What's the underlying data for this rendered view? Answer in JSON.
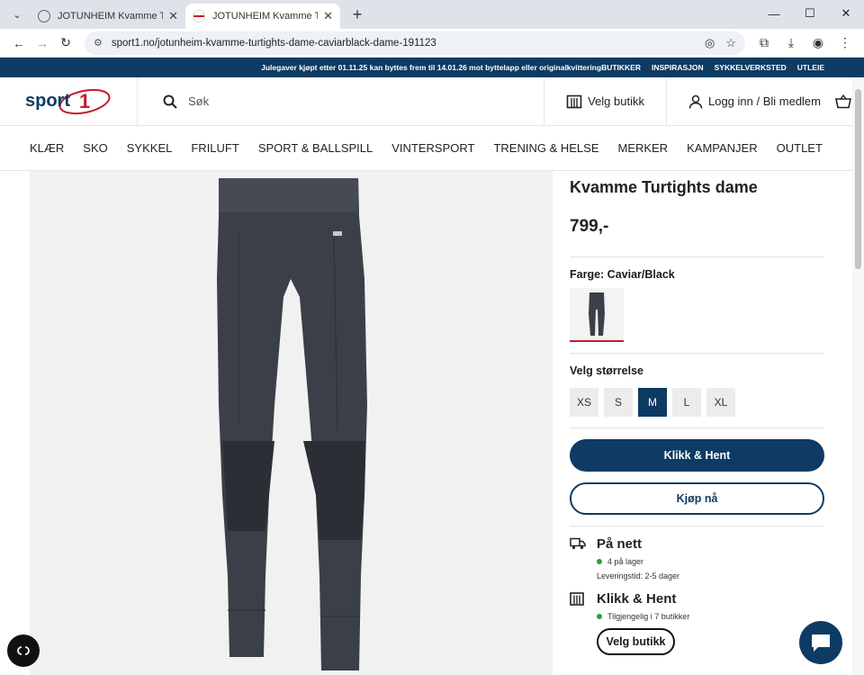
{
  "browser": {
    "tabs": [
      {
        "title": "JOTUNHEIM Kvamme Turtights",
        "active": false
      },
      {
        "title": "JOTUNHEIM Kvamme Turtights",
        "active": true
      }
    ],
    "url": "sport1.no/jotunheim-kvamme-turtights-dame-caviarblack-dame-191123"
  },
  "promo": {
    "message": "Julegaver kjøpt etter 01.11.25 kan byttes frem til 14.01.26 mot byttelapp eller originalkvittering",
    "links": [
      "BUTIKKER",
      "INSPIRASJON",
      "SYKKELVERKSTED",
      "UTLEIE"
    ]
  },
  "header": {
    "logo_text": "sport",
    "logo_num": "1",
    "search_placeholder": "Søk",
    "store_label": "Velg butikk",
    "login_label": "Logg inn / Bli medlem"
  },
  "nav": [
    "KLÆR",
    "SKO",
    "SYKKEL",
    "FRILUFT",
    "SPORT & BALLSPILL",
    "VINTERSPORT",
    "TRENING & HELSE",
    "MERKER",
    "KAMPANJER",
    "OUTLET"
  ],
  "product": {
    "name": "Kvamme Turtights dame",
    "price": "799,-",
    "color_label": "Farge: Caviar/Black",
    "size_label": "Velg størrelse",
    "sizes": [
      "XS",
      "S",
      "M",
      "L",
      "XL"
    ],
    "selected_size": "M",
    "primary_button": "Klikk & Hent",
    "secondary_button": "Kjøp nå"
  },
  "availability": {
    "online_title": "På nett",
    "online_stock": "4 på lager",
    "delivery": "Leveringstid: 2-5 dager",
    "pickup_title": "Klikk & Hent",
    "pickup_stock": "Tilgjengelig i 7 butikker",
    "pickup_button": "Velg butikk"
  },
  "colors": {
    "brand": "#0e3b63",
    "accent_red": "#c31c2e",
    "stock_green": "#2e9e3a"
  }
}
